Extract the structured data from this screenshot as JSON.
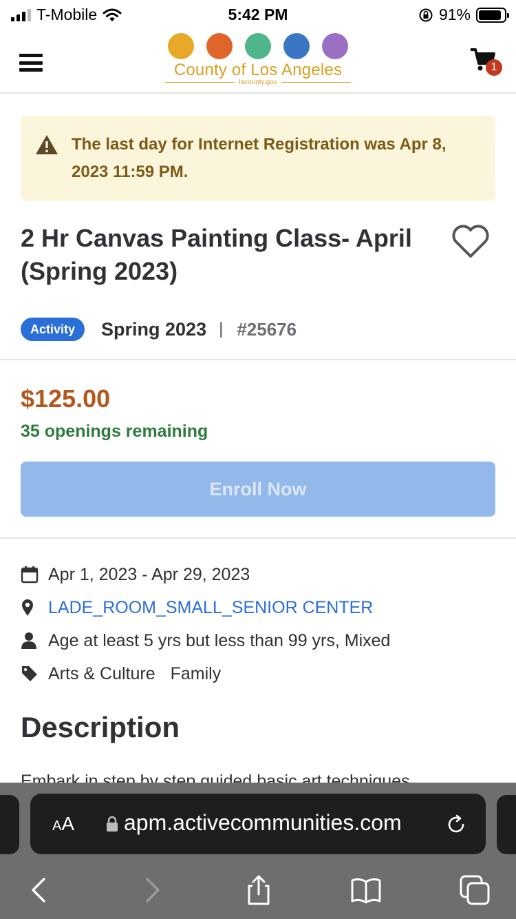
{
  "status_bar": {
    "carrier": "T-Mobile",
    "time": "5:42 PM",
    "battery": "91%"
  },
  "header": {
    "logo_title": "County of Los Angeles",
    "logo_sub": "lacounty.gov",
    "logo_colors": [
      "#e8a928",
      "#e0652b",
      "#4fb58b",
      "#3b76c4",
      "#9b6fc4"
    ],
    "cart_count": "1"
  },
  "alert": {
    "text": "The last day for Internet Registration was Apr 8, 2023 11:59 PM."
  },
  "activity": {
    "title": "2 Hr Canvas Painting Class- April (Spring 2023)",
    "badge": "Activity",
    "season": "Spring 2023",
    "separator": "|",
    "number": "#25676",
    "price": "$125.00",
    "openings": "35 openings remaining",
    "enroll_label": "Enroll Now"
  },
  "details": {
    "dates": "Apr 1, 2023 - Apr 29, 2023",
    "location": "LADE_ROOM_SMALL_SENIOR CENTER",
    "age": "Age at least 5 yrs but less than 99 yrs, Mixed",
    "tags": [
      "Arts & Culture",
      "Family"
    ]
  },
  "description": {
    "heading": "Description",
    "text": "Embark in step by step guided basic art techniques"
  },
  "browser": {
    "aa_label_small": "A",
    "aa_label": "A",
    "url": "apm.activecommunities.com"
  },
  "colors": {
    "accent": "#2a6fd8",
    "price": "#b4571e",
    "openings": "#2e7b3e",
    "alert_bg": "#fbf5dc"
  }
}
